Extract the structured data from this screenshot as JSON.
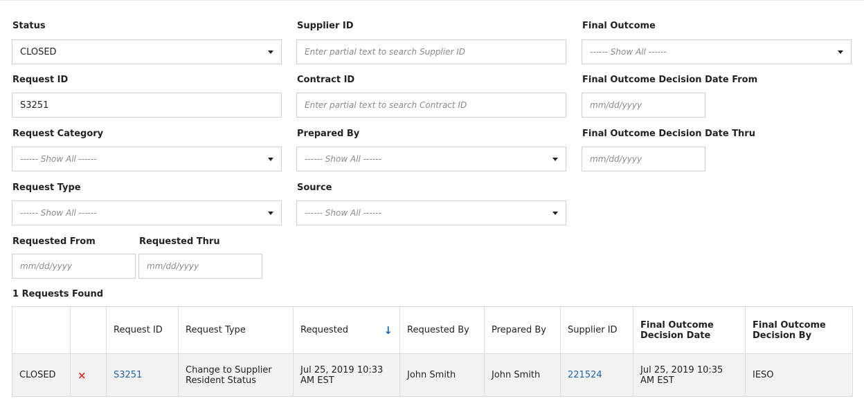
{
  "filters": {
    "status": {
      "label": "Status",
      "value": "CLOSED"
    },
    "supplier_id": {
      "label": "Supplier ID",
      "placeholder": "Enter partial text to search  Supplier ID"
    },
    "final_outcome": {
      "label": "Final Outcome",
      "value": "------ Show All ------"
    },
    "request_id": {
      "label": "Request ID",
      "value": "S3251"
    },
    "contract_id": {
      "label": "Contract ID",
      "placeholder": "Enter partial text to search  Contract ID"
    },
    "final_outcome_from": {
      "label": "Final Outcome Decision Date From",
      "placeholder": "mm/dd/yyyy"
    },
    "request_category": {
      "label": "Request Category",
      "value": "------ Show All ------"
    },
    "prepared_by": {
      "label": "Prepared By",
      "value": "------ Show All ------"
    },
    "final_outcome_thru": {
      "label": "Final Outcome Decision Date Thru",
      "placeholder": "mm/dd/yyyy"
    },
    "request_type": {
      "label": "Request Type",
      "value": "------ Show All ------"
    },
    "source": {
      "label": "Source",
      "value": "------ Show All ------"
    },
    "requested_from": {
      "label": "Requested From",
      "placeholder": "mm/dd/yyyy"
    },
    "requested_thru": {
      "label": "Requested Thru",
      "placeholder": "mm/dd/yyyy"
    }
  },
  "results": {
    "count_text": "1 Requests Found",
    "columns": [
      "",
      "",
      "Request ID",
      "Request Type",
      "Requested",
      "Requested By",
      "Prepared By",
      "Supplier ID",
      "Final Outcome Decision Date",
      "Final Outcome Decision By"
    ],
    "rows": [
      {
        "status": "CLOSED",
        "action_icon": "delete-icon",
        "action_glyph": "×",
        "request_id": "S3251",
        "request_type": "Change to Supplier Resident Status",
        "requested": "Jul 25, 2019 10:33 AM  EST",
        "requested_by": "John Smith",
        "prepared_by": "John Smith",
        "supplier_id": "221524",
        "final_outcome_date": "Jul 25, 2019  10:35 AM  EST",
        "final_outcome_by": "IESO"
      }
    ],
    "sort_icon": "sort-descending-icon",
    "sort_glyph": "↓"
  },
  "colors": {
    "link": "#1f64a8",
    "delete": "#d9302a",
    "row_bg": "#f2f2f2",
    "border": "#cfcfcf"
  }
}
